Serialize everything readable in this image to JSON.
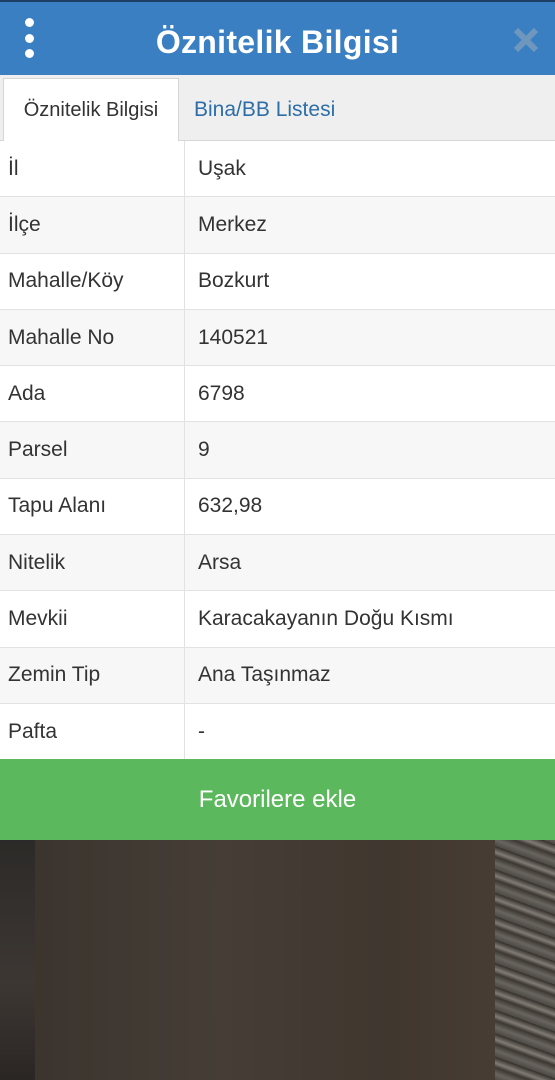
{
  "header": {
    "title": "Öznitelik Bilgisi",
    "menu_icon": "vertical-dots-icon",
    "close_icon": "close-icon",
    "background": "#3a7fc1"
  },
  "tabs": [
    {
      "label": "Öznitelik Bilgisi",
      "active": true
    },
    {
      "label": "Bina/BB Listesi",
      "active": false
    }
  ],
  "attributes": [
    {
      "key": "İl",
      "value": "Uşak"
    },
    {
      "key": "İlçe",
      "value": "Merkez"
    },
    {
      "key": "Mahalle/Köy",
      "value": "Bozkurt"
    },
    {
      "key": "Mahalle No",
      "value": "140521"
    },
    {
      "key": "Ada",
      "value": "6798"
    },
    {
      "key": "Parsel",
      "value": "9"
    },
    {
      "key": "Tapu Alanı",
      "value": "632,98"
    },
    {
      "key": "Nitelik",
      "value": "Arsa"
    },
    {
      "key": "Mevkii",
      "value": "Karacakayanın Doğu Kısmı"
    },
    {
      "key": "Zemin Tip",
      "value": "Ana Taşınmaz"
    },
    {
      "key": "Pafta",
      "value": "-"
    }
  ],
  "favorite_button": {
    "label": "Favorilere ekle",
    "color": "#5cb85c"
  }
}
